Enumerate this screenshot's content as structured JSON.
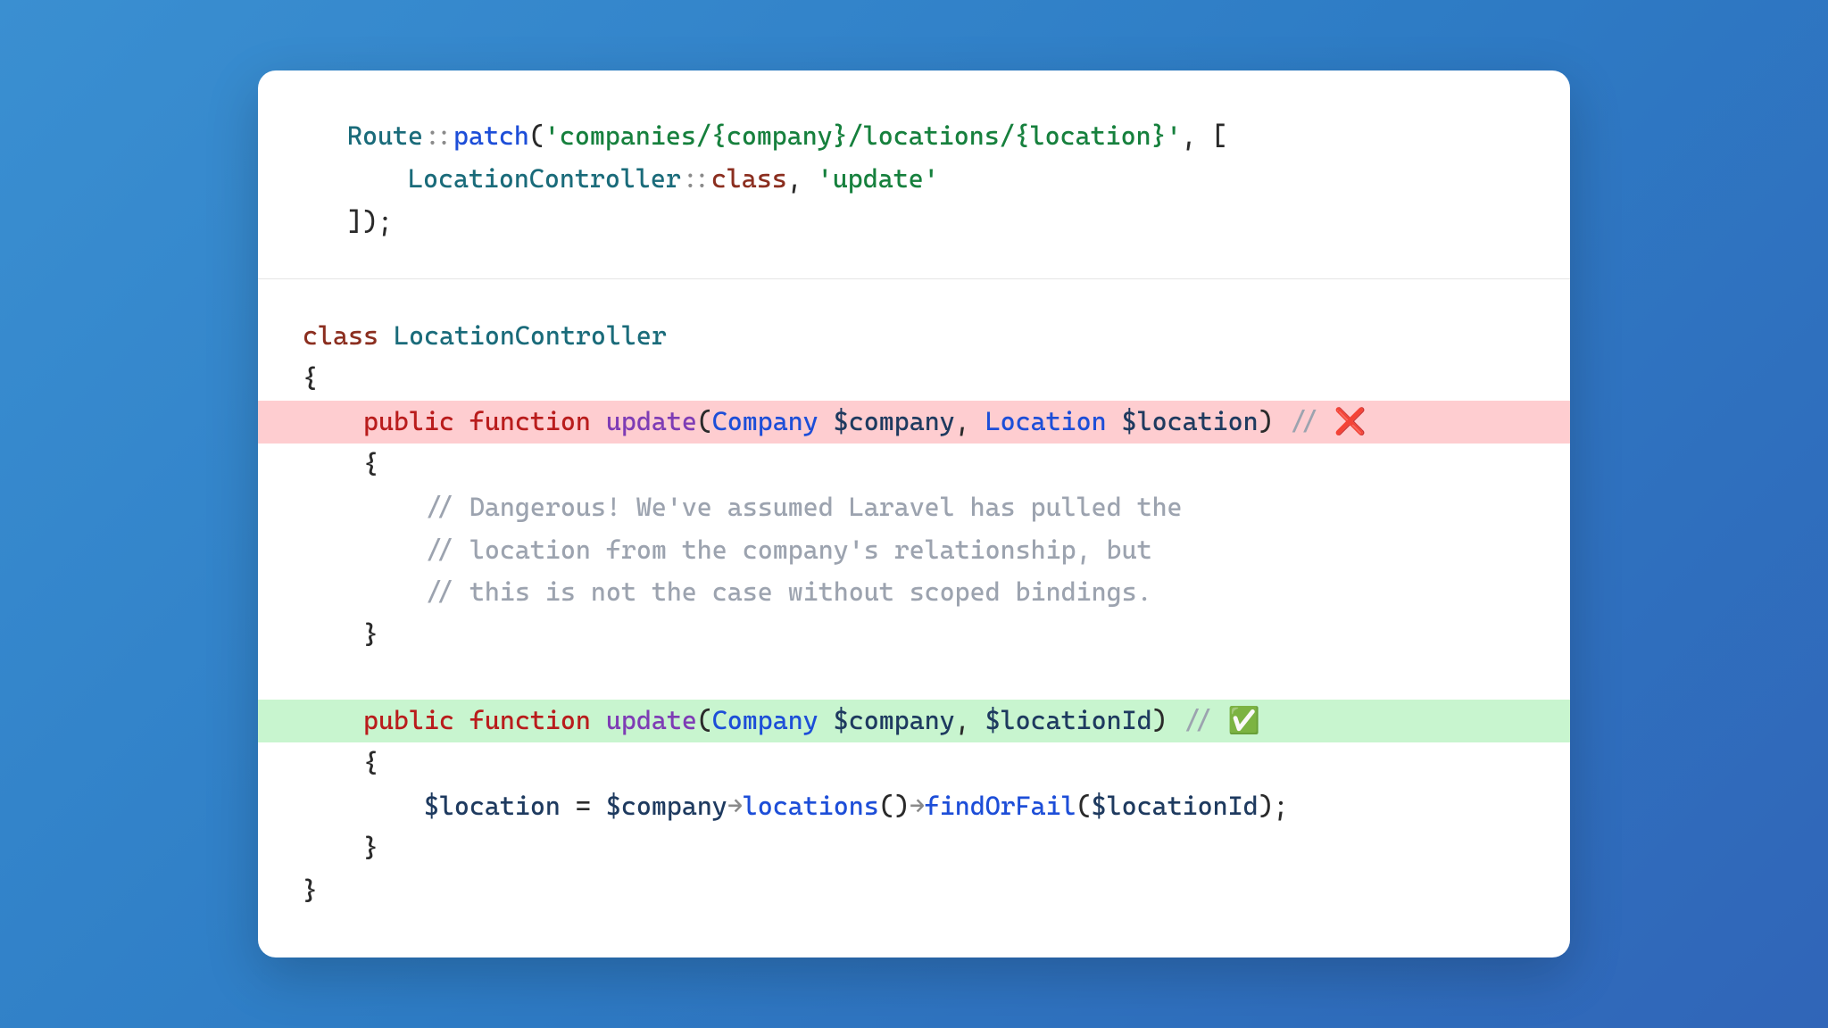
{
  "top": {
    "l1": {
      "route": "Route",
      "dcolon": "::",
      "patch": "patch",
      "lparen": "(",
      "str": "'companies/{company}/locations/{location}'",
      "comma": ", [",
      "end": ""
    },
    "l2": {
      "indent": "    ",
      "ctrl": "LocationController",
      "dcolon": "::",
      "cls": "class",
      "comma": ", ",
      "str": "'update'"
    },
    "l3": {
      "close": "]);"
    }
  },
  "bottom": {
    "l1": {
      "kw": "class",
      "sp": " ",
      "name": "LocationController"
    },
    "l2": {
      "brace": "{"
    },
    "l3": {
      "indent": "    ",
      "pub": "public",
      "sp1": " ",
      "fn": "function",
      "sp2": " ",
      "method": "update",
      "lparen": "(",
      "t1": "Company",
      "sp3": " ",
      "v1": "$company",
      "c1": ", ",
      "t2": "Location",
      "sp4": " ",
      "v2": "$location",
      "rparen": ") ",
      "comment": "// ",
      "emoji": "❌"
    },
    "l4": {
      "indent": "    ",
      "brace": "{"
    },
    "l5": {
      "indent": "        ",
      "c": "// Dangerous! We've assumed Laravel has pulled the"
    },
    "l6": {
      "indent": "        ",
      "c": "// location from the company's relationship, but"
    },
    "l7": {
      "indent": "        ",
      "c": "// this is not the case without scoped bindings."
    },
    "l8": {
      "indent": "    ",
      "brace": "}"
    },
    "l9": {
      "blank": " "
    },
    "l10": {
      "indent": "    ",
      "pub": "public",
      "sp1": " ",
      "fn": "function",
      "sp2": " ",
      "method": "update",
      "lparen": "(",
      "t1": "Company",
      "sp3": " ",
      "v1": "$company",
      "c1": ", ",
      "v2": "$locationId",
      "rparen": ") ",
      "comment": "// ",
      "emoji": "✅"
    },
    "l11": {
      "indent": "    ",
      "brace": "{"
    },
    "l12": {
      "indent": "        ",
      "var": "$location",
      "eq": " = ",
      "v1": "$company",
      "arr1": "→",
      "m1": "locations",
      "p1": "()",
      "arr2": "→",
      "m2": "findOrFail",
      "lparen": "(",
      "v2": "$locationId",
      "rparen": ");"
    },
    "l13": {
      "indent": "    ",
      "brace": "}"
    },
    "l14": {
      "brace": "}"
    }
  }
}
